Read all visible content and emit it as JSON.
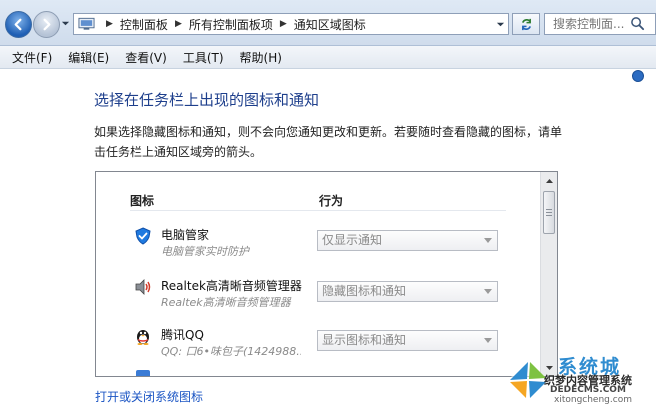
{
  "address_bar": {
    "breadcrumbs": [
      "控制面板",
      "所有控制面板项",
      "通知区域图标"
    ],
    "search_placeholder": "搜索控制面..."
  },
  "menu": {
    "items": [
      "文件(F)",
      "编辑(E)",
      "查看(V)",
      "工具(T)",
      "帮助(H)"
    ]
  },
  "content": {
    "title": "选择在任务栏上出现的图标和通知",
    "description": "如果选择隐藏图标和通知，则不会向您通知更改和更新。若要随时查看隐藏的图标，请单击任务栏上通知区域旁的箭头。",
    "columns": {
      "icon": "图标",
      "behavior": "行为"
    },
    "rows": [
      {
        "name": "电脑管家",
        "sub": "电脑管家实时防护",
        "behavior": "仅显示通知",
        "icon": "shield-icon"
      },
      {
        "name": "Realtek高清晰音频管理器",
        "sub": "Realtek高清晰音频管理器",
        "behavior": "隐藏图标和通知",
        "icon": "speaker-icon"
      },
      {
        "name": "腾讯QQ",
        "sub": "QQ: 口6•味包子(1424988...",
        "behavior": "显示图标和通知",
        "icon": "qq-penguin-icon"
      }
    ],
    "link": "打开或关闭系统图标"
  },
  "watermark": {
    "big": "系统城",
    "line1": "织梦内容管理系统",
    "line2": "DEDECMS.COM",
    "line3": "xitongcheng.com"
  },
  "colors": {
    "title_blue": "#1e3f8c",
    "link_blue": "#1b55c4",
    "chrome_blue": "#cfdcec"
  }
}
